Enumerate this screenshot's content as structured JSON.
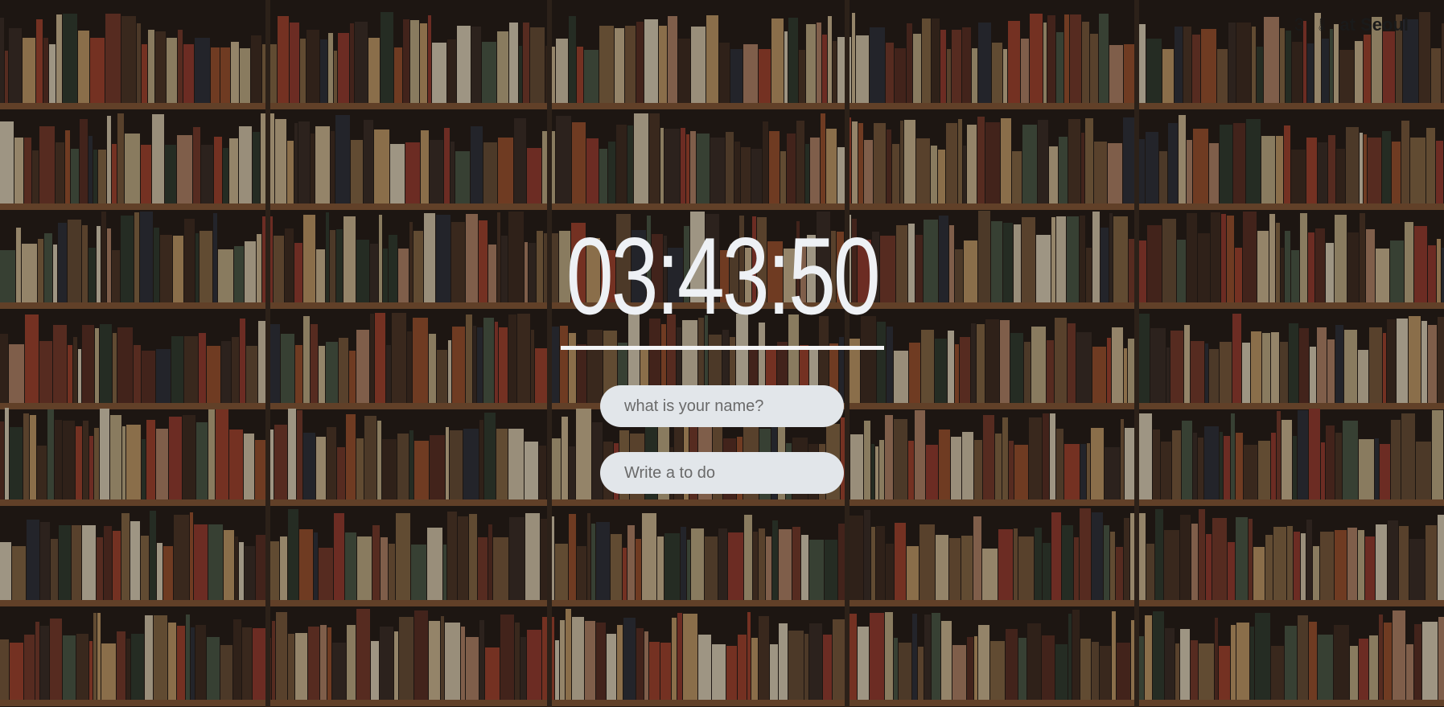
{
  "weather": {
    "temperature": "3",
    "thermometer_glyph": "🌡",
    "location_text": "at Seoul"
  },
  "clock": {
    "time": "03:43:50"
  },
  "name_form": {
    "placeholder": "what is your name?"
  },
  "todo_form": {
    "placeholder": "Write a to do"
  },
  "colors": {
    "clock_text": "#eef1f5",
    "input_bg": "#e2e6ea",
    "shelf_wood": "#8a5a36"
  }
}
